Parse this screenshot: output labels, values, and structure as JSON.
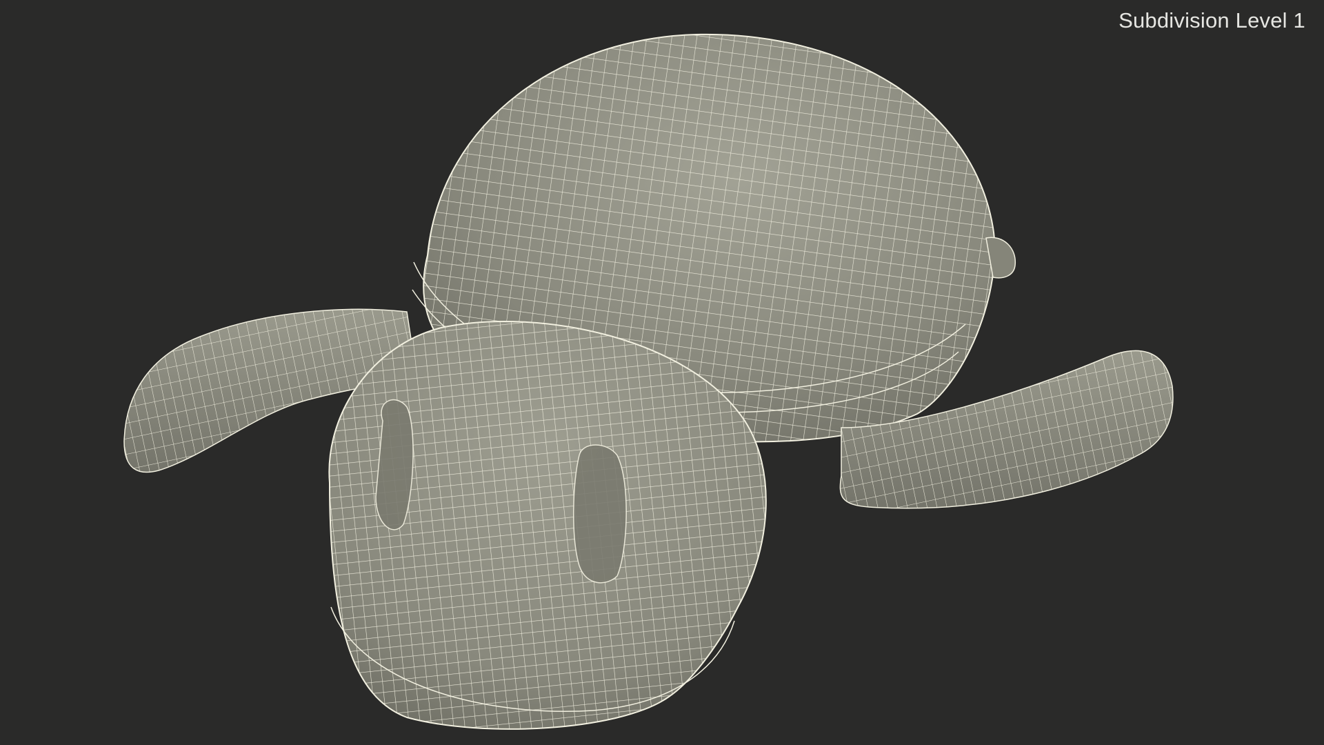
{
  "viewport": {
    "caption": "Subdivision Level 1"
  },
  "colors": {
    "background": "#2a2a29",
    "surface": "#8a8a7e",
    "surface_dark": "#6f6f65",
    "surface_light": "#a2a295",
    "wire": "#f2f0e0",
    "caption": "#e6e6e2"
  },
  "model": {
    "name": "wireframe-mesh",
    "parts": [
      "main-shell",
      "front-shell",
      "left-strap",
      "right-strap",
      "side-knob"
    ]
  }
}
